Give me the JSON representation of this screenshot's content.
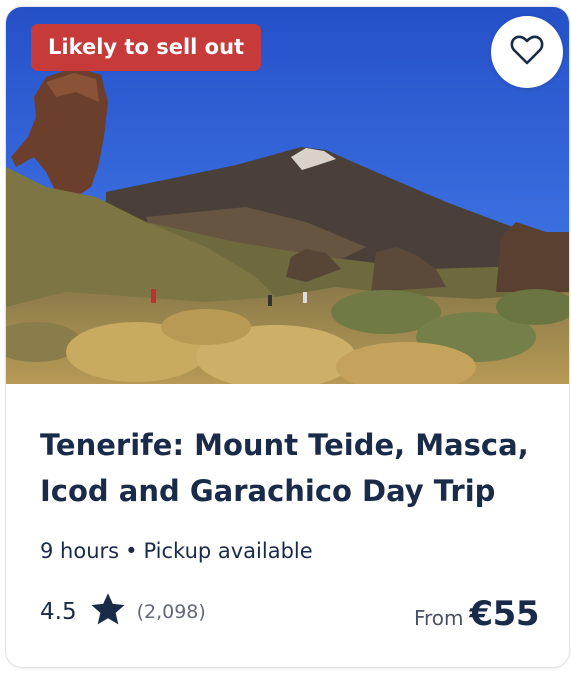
{
  "badge": {
    "label": "Likely to sell out"
  },
  "wishlist": {
    "icon": "heart-outline-icon"
  },
  "photo": {
    "subject": "Mount Teide volcano with rock formation and dry grass"
  },
  "tour": {
    "title": "Tenerife: Mount Teide, Masca, Icod and Garachico Day Trip",
    "duration": "9 hours",
    "separator": "•",
    "pickup": "Pickup available"
  },
  "rating": {
    "score": "4.5",
    "star_icon": "star-icon",
    "count": "(2,098)"
  },
  "price": {
    "prefix": "From",
    "amount": "€55"
  },
  "colors": {
    "badge": "#c63a3a",
    "text_primary": "#1a2b49",
    "text_muted": "#63687a"
  }
}
